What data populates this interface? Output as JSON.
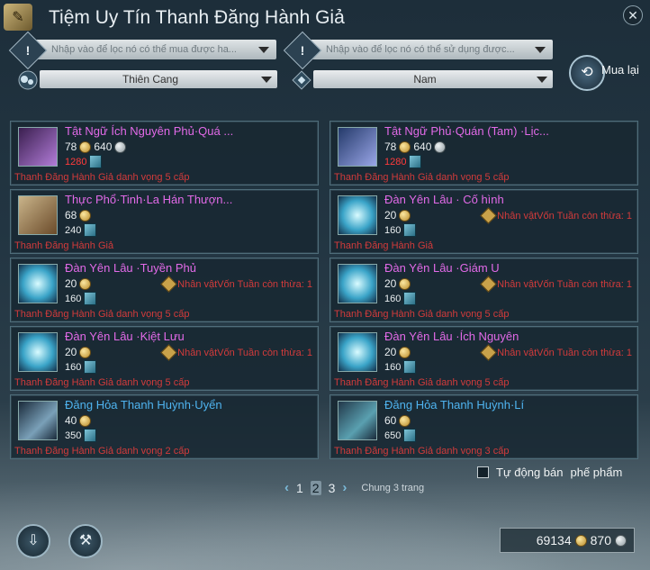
{
  "window": {
    "title": "Tiệm Uy Tín Thanh Đăng Hành Giả",
    "title_icon": "scroll-icon",
    "close_icon": "close-icon"
  },
  "filters": {
    "buyable_placeholder": "Nhập vào để lọc nó có thể  mua được ha...",
    "usable_placeholder": "Nhập vào để lọc nó có thể sử dụng được...",
    "sect_value": "Thiên Cang",
    "gender_value": "Nam"
  },
  "buyback": {
    "label": "Mua lại"
  },
  "items": [
    {
      "name": "Tật Ngữ Ích Nguyên Phủ·Quá ...",
      "color": "#e26ae8",
      "price": "78",
      "silver": "640",
      "ticket": "1280",
      "ticket_red": true,
      "requirement": "Thanh Đăng Hành Giả danh vọng 5 cấp",
      "weekly": ""
    },
    {
      "name": "Tật Ngữ Phủ·Quán (Tam) ·Lịc...",
      "color": "#e26ae8",
      "price": "78",
      "silver": "640",
      "ticket": "1280",
      "ticket_red": true,
      "requirement": "Thanh Đăng Hành Giả danh vọng 5 cấp",
      "weekly": ""
    },
    {
      "name": "Thực Phổ·Tinh·La Hán Thượn...",
      "color": "#e26ae8",
      "price": "68",
      "silver": "",
      "ticket": "240",
      "ticket_red": false,
      "requirement": "Thanh Đăng Hành Giả",
      "weekly": ""
    },
    {
      "name": "Đàn Yên Lâu · Cố hình",
      "color": "#e26ae8",
      "price": "20",
      "silver": "",
      "ticket": "160",
      "ticket_red": false,
      "requirement": "Thanh Đăng Hành Giả",
      "weekly": "Nhân vậtVốn Tuần còn thừa: 1"
    },
    {
      "name": "Đàn Yên Lâu ·Tuyền Phủ",
      "color": "#e26ae8",
      "price": "20",
      "silver": "",
      "ticket": "160",
      "ticket_red": false,
      "requirement": "Thanh Đăng Hành Giả danh vọng 5 cấp",
      "weekly": "Nhân vậtVốn Tuần còn thừa: 1"
    },
    {
      "name": "Đàn Yên Lâu ·Giám U",
      "color": "#e26ae8",
      "price": "20",
      "silver": "",
      "ticket": "160",
      "ticket_red": false,
      "requirement": "Thanh Đăng Hành Giả danh vọng 5 cấp",
      "weekly": "Nhân vậtVốn Tuần còn thừa: 1"
    },
    {
      "name": "Đàn Yên Lâu ·Kiệt Lưu",
      "color": "#e26ae8",
      "price": "20",
      "silver": "",
      "ticket": "160",
      "ticket_red": false,
      "requirement": "Thanh Đăng Hành Giả danh vọng 5 cấp",
      "weekly": "Nhân vậtVốn Tuần còn thừa: 1"
    },
    {
      "name": "Đàn Yên Lâu ·Ích Nguyên",
      "color": "#e26ae8",
      "price": "20",
      "silver": "",
      "ticket": "160",
      "ticket_red": false,
      "requirement": "Thanh Đăng Hành Giả danh vọng 5 cấp",
      "weekly": "Nhân vậtVốn Tuần còn thừa: 1"
    },
    {
      "name": "Đăng Hỏa Thanh Huỳnh·Uyển",
      "color": "#4fb4f0",
      "price": "40",
      "silver": "",
      "ticket": "350",
      "ticket_red": false,
      "requirement": "Thanh Đăng Hành Giả danh vọng 2 cấp",
      "weekly": ""
    },
    {
      "name": "Đăng Hỏa Thanh Huỳnh·Lí",
      "color": "#4fb4f0",
      "price": "60",
      "silver": "",
      "ticket": "650",
      "ticket_red": false,
      "requirement": "Thanh Đăng Hành Giả danh vọng 3 cấp",
      "weekly": ""
    }
  ],
  "pagination": {
    "pages": [
      "1",
      "2",
      "3"
    ],
    "current": "2",
    "total": "Chung 3 trang"
  },
  "auto_sell": {
    "label": "Tự động bán",
    "sub_label": "phế phẩm",
    "checked": false
  },
  "wallet": {
    "gold": "69134",
    "silver": "870"
  }
}
